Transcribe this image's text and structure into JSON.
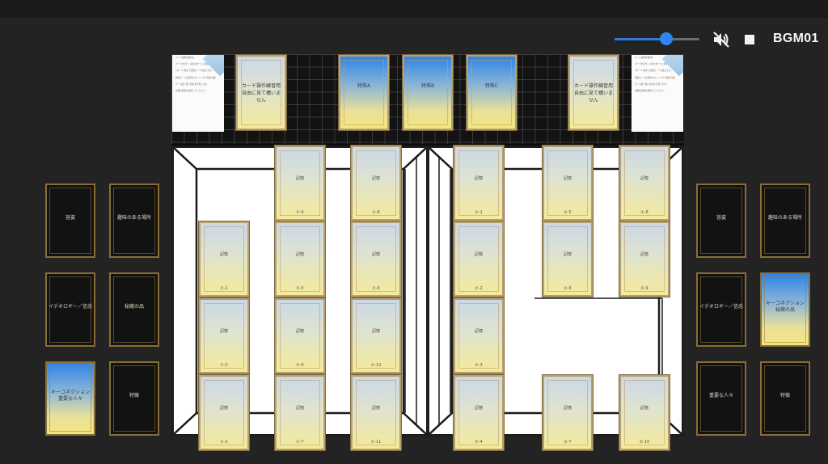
{
  "audio": {
    "volume": 0.61,
    "bgm_label": "BGM01",
    "mute_icon": "volume-mute-icon",
    "stop_icon": "stop-icon"
  },
  "top_row": {
    "docs": [
      {
        "title": "ルール説明文書(仮)",
        "lines": [
          "カードを引き、自分のターンに場に出します。",
          "1ターン1枚まで記憶カードを使えます。",
          "特殊カードは任意のタイミングで使用可能。",
          "ゲーム終了時に得点を計算します。",
          "詳細は別紙を参照してください。"
        ]
      },
      {
        "title": "ルール説明文書(仮)",
        "lines": [
          "カードを引き、自分のターンに場に出します。",
          "1ターン1枚まで記憶カードを使えます。",
          "特殊カードは任意のタイミングで使用可能。",
          "ゲーム終了時に得点を計算します。",
          "詳細は別紙を参照してください。"
        ]
      }
    ],
    "practice_label": "カード操作練習用\n自由に見て構いません",
    "special_cards": [
      "特殊A",
      "特殊B",
      "特殊C"
    ]
  },
  "memory": {
    "label": "記憶",
    "left_numbers": [
      "①-1",
      "①-2",
      "①-3",
      "①-4",
      "①-5",
      "①-6",
      "①-7",
      "①-8",
      "①-9",
      "①-10",
      "①-11"
    ],
    "right_numbers": [
      "②-1",
      "②-2",
      "②-3",
      "②-4",
      "②-5",
      "②-6",
      "②-7",
      "②-8",
      "②-9",
      "②-10"
    ]
  },
  "side_slots": {
    "left": [
      "容姿",
      "趣味のある場所",
      "イデオロギー／信念",
      "秘蔵の品",
      "キーコネクション\n重要な人々",
      "特徴"
    ],
    "right": [
      "容姿",
      "趣味のある場所",
      "イデオロギー／信念",
      "キーコネクション\n秘蔵の品",
      "重要な人々",
      "特徴"
    ]
  },
  "colors": {
    "accent_blue": "#2f86f0",
    "card_gold": "#b8a070",
    "slot_gold": "#8a6d36",
    "background": "#232323"
  }
}
